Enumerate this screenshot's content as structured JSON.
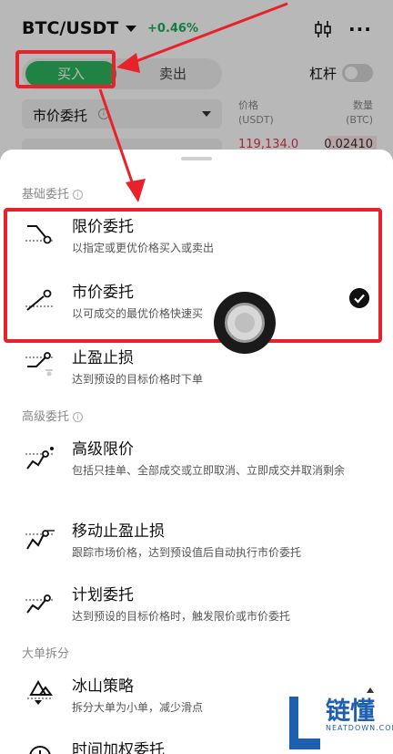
{
  "header": {
    "pair": "BTC/USDT",
    "change": "+0.46%",
    "more": "···"
  },
  "trade": {
    "buy_label": "买入",
    "sell_label": "卖出",
    "leverage_label": "杠杆",
    "order_type": "市价委托",
    "order_type_info": "i"
  },
  "orderbook": {
    "price_header": "价格",
    "price_unit": "(USDT)",
    "qty_header": "数量",
    "qty_unit": "(BTC)",
    "price": "119,134.0",
    "qty": "0.02410"
  },
  "sheet": {
    "sections": {
      "basic": "基础委托",
      "advanced": "高级委托",
      "split": "大单拆分"
    },
    "info_glyph": "i",
    "options": [
      {
        "title": "限价委托",
        "desc": "以指定或更优价格买入或卖出",
        "icon": "limit-order-icon",
        "selected": false
      },
      {
        "title": "市价委托",
        "desc": "以可成交的最优价格快速买",
        "icon": "market-order-icon",
        "selected": true
      },
      {
        "title": "止盈止损",
        "desc": "达到预设的目标价格时下单",
        "icon": "tp-sl-icon",
        "selected": false
      },
      {
        "title": "高级限价",
        "desc": "包括只挂单、全部成交或立即取消、立即成交并取消剩余",
        "icon": "advanced-limit-icon",
        "selected": false
      },
      {
        "title": "移动止盈止损",
        "desc": "跟踪市场价格，达到预设值后自动执行市价委托",
        "icon": "trailing-stop-icon",
        "selected": false
      },
      {
        "title": "计划委托",
        "desc": "达到预设的目标价格时，触发限价或市价委托",
        "icon": "trigger-order-icon",
        "selected": false
      },
      {
        "title": "冰山策略",
        "desc": "拆分大单为小单，减少滑点",
        "icon": "iceberg-icon",
        "selected": false
      },
      {
        "title": "时间加权委托",
        "desc": "",
        "icon": "twap-icon",
        "selected": false
      }
    ]
  },
  "watermark": {
    "text": "链懂",
    "sub": "NEATDOWN.COM"
  },
  "colors": {
    "buy": "#2db65f",
    "sell_price": "#e0394f",
    "change": "#1fae5a",
    "annotation": "#e8212a",
    "watermark": "#1f5fb0"
  }
}
